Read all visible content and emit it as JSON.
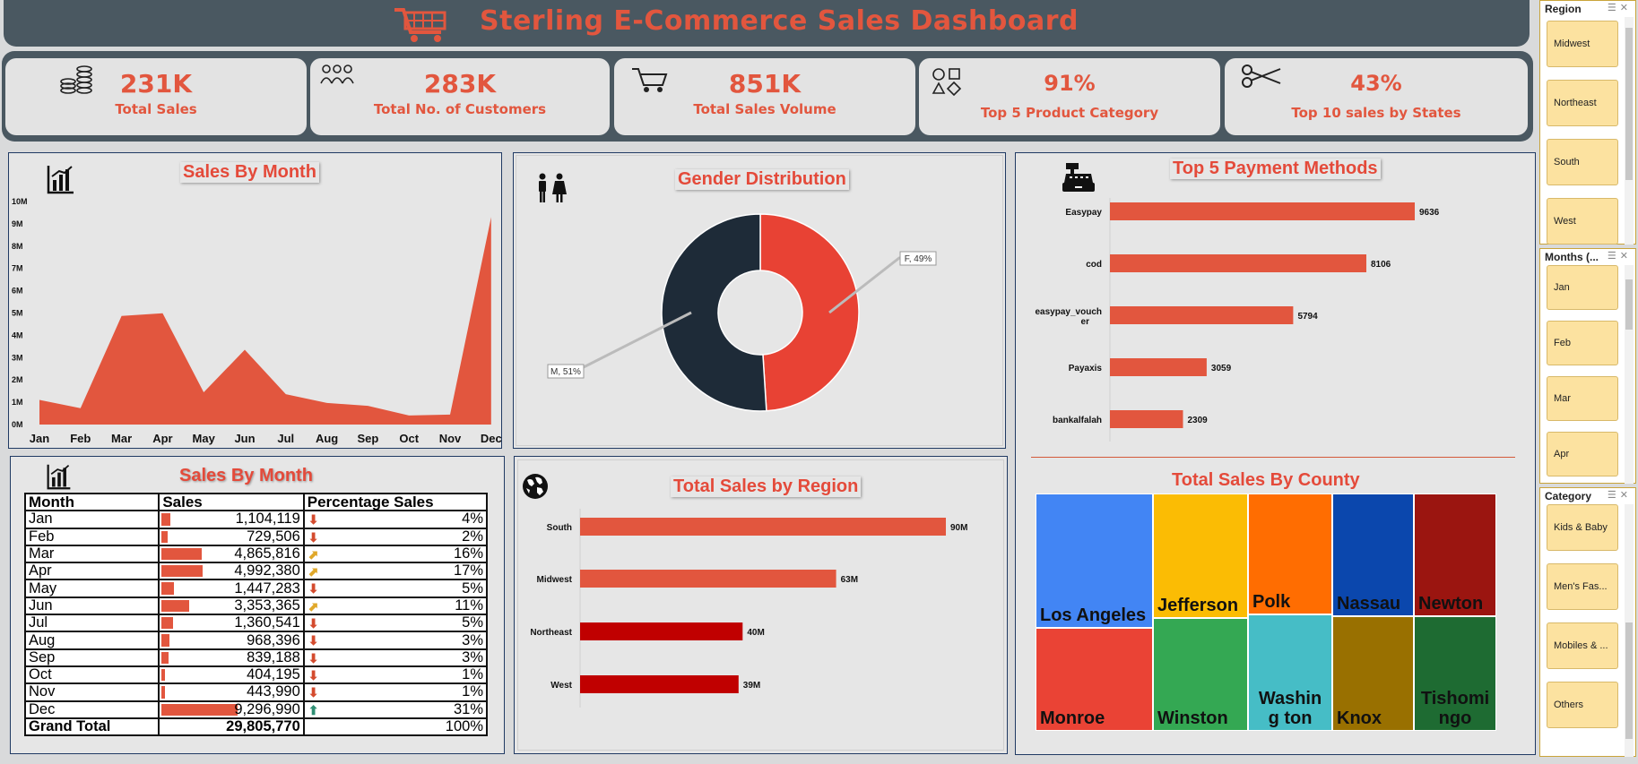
{
  "header": {
    "title": "Sterling E-Commerce Sales Dashboard"
  },
  "kpis": [
    {
      "value": "231K",
      "label": "Total Sales",
      "icon": "coins-icon"
    },
    {
      "value": "283K",
      "label": "Total No. of Customers",
      "icon": "people-icon"
    },
    {
      "value": "851K",
      "label": "Total Sales Volume",
      "icon": "cart-icon"
    },
    {
      "value": "91%",
      "label": "Top 5 Product Category",
      "icon": "shapes-icon"
    },
    {
      "value": "43%",
      "label": "Top 10 sales by States",
      "icon": "scissors-icon"
    }
  ],
  "sales_by_month_chart": {
    "title": "Sales By Month",
    "y_ticks": [
      "10M",
      "9M",
      "8M",
      "7M",
      "6M",
      "5M",
      "4M",
      "3M",
      "2M",
      "1M",
      "0M"
    ]
  },
  "gender": {
    "title": "Gender Distribution",
    "label_f": "F, 49%",
    "label_m": "M, 51%"
  },
  "payment": {
    "title": "Top 5 Payment Methods"
  },
  "table": {
    "title": "Sales By Month",
    "headers": [
      "Month",
      "Sales",
      "Percentage Sales"
    ],
    "rows": [
      {
        "month": "Jan",
        "sales": "1,104,119",
        "pct": "4%",
        "ratio": 0.119,
        "arrow": "down"
      },
      {
        "month": "Feb",
        "sales": "729,506",
        "pct": "2%",
        "ratio": 0.078,
        "arrow": "down"
      },
      {
        "month": "Mar",
        "sales": "4,865,816",
        "pct": "16%",
        "ratio": 0.523,
        "arrow": "side"
      },
      {
        "month": "Apr",
        "sales": "4,992,380",
        "pct": "17%",
        "ratio": 0.537,
        "arrow": "side"
      },
      {
        "month": "May",
        "sales": "1,447,283",
        "pct": "5%",
        "ratio": 0.156,
        "arrow": "down"
      },
      {
        "month": "Jun",
        "sales": "3,353,365",
        "pct": "11%",
        "ratio": 0.361,
        "arrow": "side"
      },
      {
        "month": "Jul",
        "sales": "1,360,541",
        "pct": "5%",
        "ratio": 0.146,
        "arrow": "down"
      },
      {
        "month": "Aug",
        "sales": "968,396",
        "pct": "3%",
        "ratio": 0.104,
        "arrow": "down"
      },
      {
        "month": "Sep",
        "sales": "839,188",
        "pct": "3%",
        "ratio": 0.09,
        "arrow": "down"
      },
      {
        "month": "Oct",
        "sales": "404,195",
        "pct": "1%",
        "ratio": 0.043,
        "arrow": "down"
      },
      {
        "month": "Nov",
        "sales": "443,990",
        "pct": "1%",
        "ratio": 0.048,
        "arrow": "down"
      },
      {
        "month": "Dec",
        "sales": "9,296,990",
        "pct": "31%",
        "ratio": 1.0,
        "arrow": "up"
      }
    ],
    "total_label": "Grand Total",
    "total_sales": "29,805,770",
    "total_pct": "100%"
  },
  "region_chart": {
    "title": "Total Sales by Region"
  },
  "county": {
    "title": "Total Sales By County",
    "cells": [
      {
        "name": "Los Angeles",
        "color": "#4285f4"
      },
      {
        "name": "Monroe",
        "color": "#ea4335"
      },
      {
        "name": "Jefferson",
        "color": "#fbbc04"
      },
      {
        "name": "Winston",
        "color": "#34a853"
      },
      {
        "name": "Polk",
        "color": "#ff6d01"
      },
      {
        "name": "Washing ton",
        "color": "#46bdc6"
      },
      {
        "name": "Nassau",
        "color": "#0b47ad"
      },
      {
        "name": "Knox",
        "color": "#997000"
      },
      {
        "name": "Newton",
        "color": "#9b1510"
      },
      {
        "name": "Tishomi ngo",
        "color": "#1e6b32"
      }
    ]
  },
  "slicers": {
    "region": {
      "title": "Region",
      "items": [
        "Midwest",
        "Northeast",
        "South",
        "West"
      ]
    },
    "months": {
      "title": "Months (...",
      "items": [
        "Jan",
        "Feb",
        "Mar",
        "Apr"
      ]
    },
    "category": {
      "title": "Category",
      "items": [
        "Kids & Baby",
        "Men's Fas...",
        "Mobiles & ...",
        "Others"
      ]
    }
  },
  "colors": {
    "accent": "#e2563e",
    "dark": "#1e2b38",
    "red": "#e84234",
    "dark_red": "#c00000",
    "slicer_item": "#fce2a0"
  },
  "chart_data": [
    {
      "type": "area",
      "title": "Sales By Month",
      "categories": [
        "Jan",
        "Feb",
        "Mar",
        "Apr",
        "May",
        "Jun",
        "Jul",
        "Aug",
        "Sep",
        "Oct",
        "Nov",
        "Dec"
      ],
      "values": [
        1104119,
        729506,
        4865816,
        4992380,
        1447283,
        3353365,
        1360541,
        968396,
        839188,
        404195,
        443990,
        9296990
      ],
      "ylim": [
        0,
        10000000
      ]
    },
    {
      "type": "pie",
      "title": "Gender Distribution",
      "categories": [
        "F",
        "M"
      ],
      "values": [
        49,
        51
      ]
    },
    {
      "type": "bar",
      "title": "Top 5 Payment Methods",
      "categories": [
        "Easypay",
        "cod",
        "easypay_voucher",
        "Payaxis",
        "bankalfalah"
      ],
      "values": [
        9636,
        8106,
        5794,
        3059,
        2309
      ]
    },
    {
      "type": "bar",
      "title": "Total Sales by Region",
      "categories": [
        "South",
        "Midwest",
        "Northeast",
        "West"
      ],
      "values": [
        90,
        63,
        40,
        39
      ],
      "value_labels": [
        "90M",
        "63M",
        "40M",
        "39M"
      ]
    }
  ]
}
